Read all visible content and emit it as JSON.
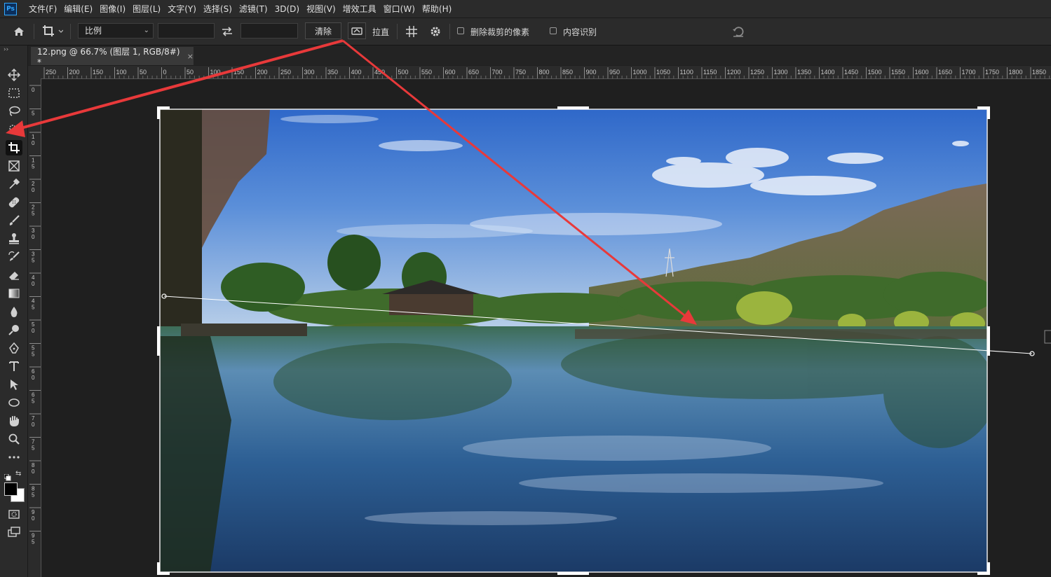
{
  "app": {
    "logo": "Ps"
  },
  "menu": [
    "文件(F)",
    "编辑(E)",
    "图像(I)",
    "图层(L)",
    "文字(Y)",
    "选择(S)",
    "滤镜(T)",
    "3D(D)",
    "视图(V)",
    "增效工具",
    "窗口(W)",
    "帮助(H)"
  ],
  "options": {
    "ratio_select": "比例",
    "width_value": "",
    "height_value": "",
    "clear_button": "清除",
    "straighten_label": "拉直",
    "delete_cropped_label": "删除裁剪的像素",
    "content_aware_label": "内容识别"
  },
  "document": {
    "tab_title": "12.png @ 66.7% (图层 1, RGB/8#) *",
    "close": "×"
  },
  "ruler_h": [
    "250",
    "200",
    "150",
    "100",
    "50",
    "0",
    "50",
    "100",
    "150",
    "200",
    "250",
    "300",
    "350",
    "400",
    "450",
    "500",
    "550",
    "600",
    "650",
    "700",
    "750",
    "800",
    "850",
    "900",
    "950",
    "1000",
    "1050",
    "1100",
    "1150",
    "1200",
    "1250",
    "1300",
    "1350",
    "1400",
    "1450",
    "1500",
    "1550",
    "1600",
    "1650",
    "1700",
    "1750",
    "1800",
    "1850"
  ],
  "ruler_v": [
    "0",
    "5",
    "1 0",
    "1 5",
    "2 0",
    "2 5",
    "3 0",
    "3 5",
    "4 0",
    "4 5",
    "5 0",
    "5 5",
    "6 0",
    "6 5",
    "7 0",
    "7 5",
    "8 0",
    "8 5",
    "9 0",
    "9 5"
  ],
  "colors": {
    "accent_arrow": "#e8393a",
    "foreground": "#000000",
    "background": "#ffffff"
  }
}
